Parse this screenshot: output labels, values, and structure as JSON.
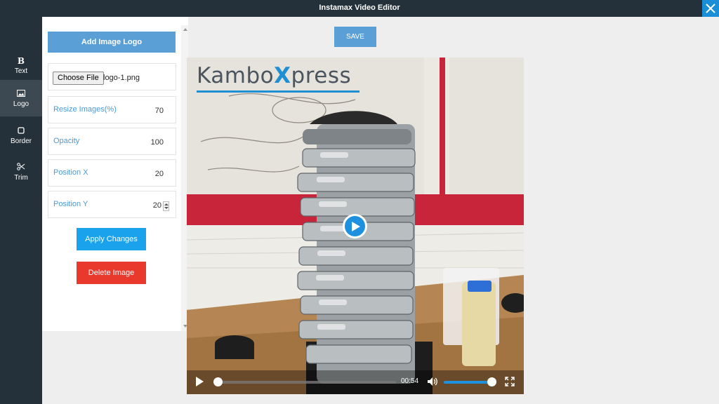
{
  "window": {
    "title": "Instamax Video Editor",
    "close_icon": "close-icon"
  },
  "sidebar": {
    "items": [
      {
        "label": "Text",
        "icon": "bold-icon",
        "glyph": "B",
        "active": false
      },
      {
        "label": "Logo",
        "icon": "image-icon",
        "active": true
      },
      {
        "label": "Border",
        "icon": "square-icon",
        "active": false
      },
      {
        "label": "Trim",
        "icon": "scissors-icon",
        "active": false
      }
    ]
  },
  "panel": {
    "add_logo_label": "Add Image Logo",
    "file": {
      "button_label": "Choose File",
      "file_name": "logo-1.png"
    },
    "fields": [
      {
        "label": "Resize Images(%)",
        "value": "70"
      },
      {
        "label": "Opacity",
        "value": "100"
      },
      {
        "label": "Position X",
        "value": "20"
      },
      {
        "label": "Position Y",
        "value": "20"
      }
    ],
    "apply_label": "Apply Changes",
    "delete_label": "Delete Image"
  },
  "toolbar": {
    "save_label": "SAVE"
  },
  "video": {
    "overlay_logo": {
      "part1": "Kambo",
      "part2": "X",
      "part3": "press"
    },
    "current_time": "00:54",
    "progress": 0.0,
    "volume": 1.0
  },
  "colors": {
    "sidebar_bg": "#25313a",
    "accent_blue": "#5a9fd6",
    "apply_blue": "#1aa3ec",
    "delete_red": "#e8392c",
    "label_blue": "#4a9ad7"
  }
}
